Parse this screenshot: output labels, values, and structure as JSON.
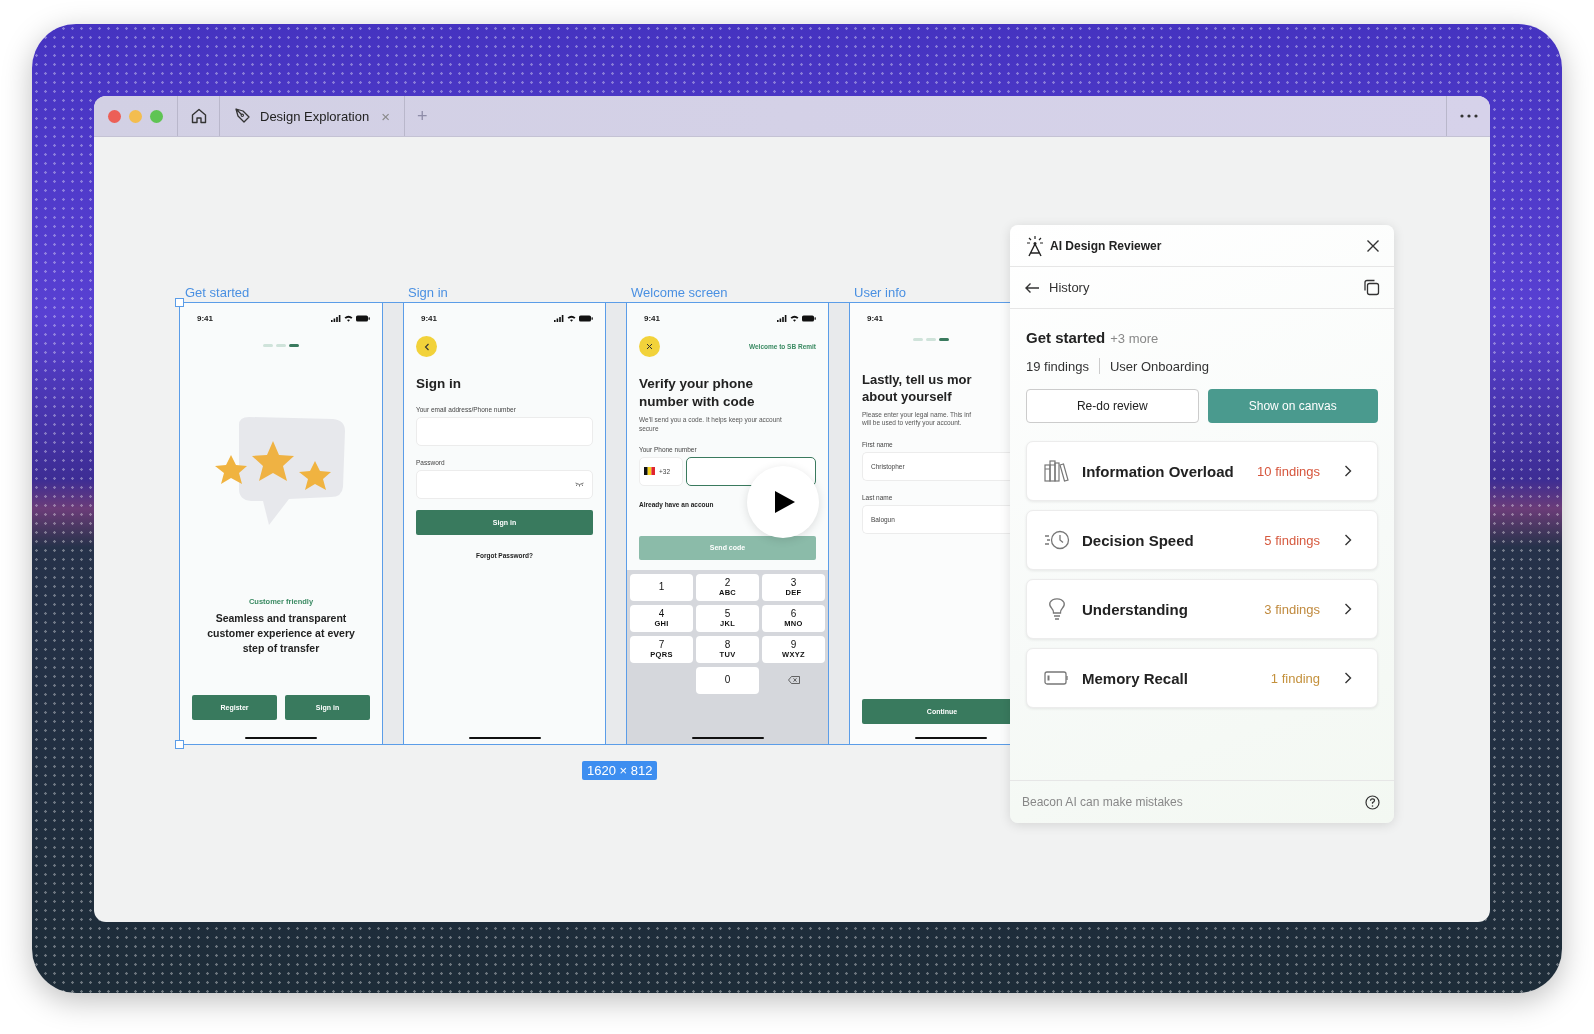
{
  "window": {
    "tab_title": "Design Exploration",
    "tab_close": "×",
    "new_tab": "+"
  },
  "canvas": {
    "selection_size": "1620 × 812",
    "frames": [
      {
        "kind": "onboarding",
        "label": "Get started",
        "time": "9:41",
        "steps": [
          {
            "selected": false
          },
          {
            "selected": false
          },
          {
            "selected": true
          }
        ],
        "eyebrow": "Customer friendly",
        "headline": "Seamless and transparent customer experience at every step of transfer",
        "buttons": [
          "Register",
          "Sign in"
        ]
      },
      {
        "kind": "signin",
        "label": "Sign in",
        "time": "9:41",
        "title": "Sign in",
        "fields": [
          "Your email address/Phone number",
          "Password"
        ],
        "button": "Sign in",
        "link": "Forgot Password?"
      },
      {
        "kind": "verify",
        "label": "Welcome screen",
        "time": "9:41",
        "header": "Welcome to SB Remit",
        "title": "Verify your phone number with code",
        "subtitle": "We'll send you a code. It helps keep your account secure",
        "field_label": "Your Phone number",
        "dial_code": "+32",
        "account_text": "Already have an accoun",
        "button": "Send code",
        "button_disabled": true,
        "keys": [
          {
            "kind": "digit",
            "digit": "1"
          },
          {
            "kind": "digit",
            "digit": "2",
            "letters": "ABC"
          },
          {
            "kind": "digit",
            "digit": "3",
            "letters": "DEF"
          },
          {
            "kind": "digit",
            "digit": "4",
            "letters": "GHI"
          },
          {
            "kind": "digit",
            "digit": "5",
            "letters": "JKL"
          },
          {
            "kind": "digit",
            "digit": "6",
            "letters": "MNO"
          },
          {
            "kind": "digit",
            "digit": "7",
            "letters": "PQRS"
          },
          {
            "kind": "digit",
            "digit": "8",
            "letters": "TUV"
          },
          {
            "kind": "digit",
            "digit": "9",
            "letters": "WXYZ"
          },
          {
            "kind": "blank"
          },
          {
            "kind": "digit",
            "digit": "0"
          },
          {
            "kind": "backspace"
          }
        ]
      },
      {
        "kind": "profile",
        "label": "User info",
        "time": "9:41",
        "steps": [
          {
            "selected": false
          },
          {
            "selected": false
          },
          {
            "selected": true
          }
        ],
        "title_lines": [
          "Lastly, tell us mor",
          "about yourself"
        ],
        "description_lines": [
          "Please enter your legal name. This inf",
          "will be used to verify your account."
        ],
        "fields": [
          {
            "label": "First name",
            "value": "Christopher"
          },
          {
            "label": "Last name",
            "value": "Balogun"
          }
        ],
        "button": "Continue"
      }
    ]
  },
  "reviewer": {
    "title": "AI Design Reviewer",
    "back_label": "History",
    "review_title": "Get started",
    "more": "+3 more",
    "findings_total": "19 findings",
    "flow": "User Onboarding",
    "buttons": [
      {
        "label": "Re-do review",
        "kind": "secondary"
      },
      {
        "label": "Show on canvas",
        "kind": "primary"
      }
    ],
    "categories": [
      {
        "kind": "books",
        "name": "Information Overload",
        "count": "10 findings",
        "color": "#d6553c"
      },
      {
        "kind": "clock",
        "name": "Decision Speed",
        "count": "5 findings",
        "color": "#d65a3f"
      },
      {
        "kind": "bulb",
        "name": "Understanding",
        "count": "3 findings",
        "color": "#c08a3e"
      },
      {
        "kind": "battery",
        "name": "Memory Recall",
        "count": "1 finding",
        "color": "#c4913c"
      }
    ],
    "footer": "Beacon AI can make mistakes"
  }
}
